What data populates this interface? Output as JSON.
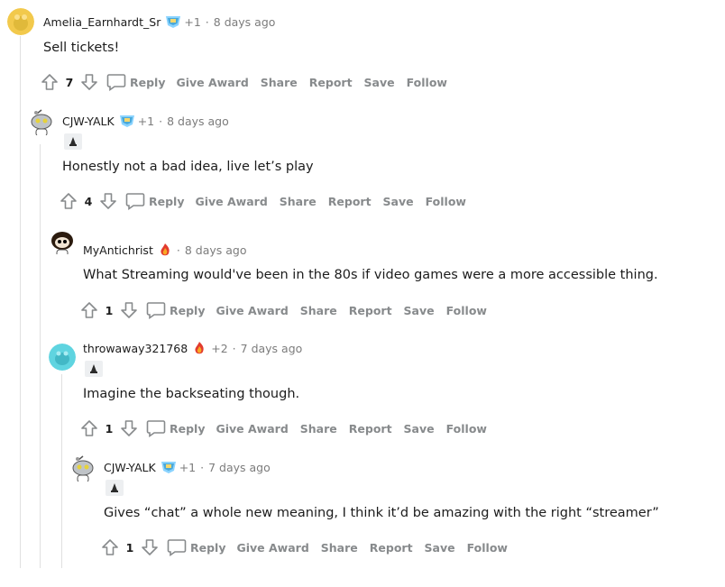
{
  "comments": [
    {
      "username": "Amelia_Earnhardt_Sr",
      "points": "+1",
      "time": "8 days ago",
      "body": "Sell tickets!",
      "score": "7",
      "avatar": "yellow-snoo"
    },
    {
      "username": "CJW-YALK",
      "points": "+1",
      "time": "8 days ago",
      "body": "Honestly not a bad idea, live let’s play",
      "score": "4",
      "avatar": "grey-snoo"
    },
    {
      "username": "MyAntichrist",
      "points": "",
      "time": "8 days ago",
      "body": "What Streaming would've been in the 80s if video games were a more accessible thing.",
      "score": "1",
      "avatar": "dark-hair-snoo"
    },
    {
      "username": "throwaway321768",
      "points": "+2",
      "time": "7 days ago",
      "body": "Imagine the backseating though.",
      "score": "1",
      "avatar": "teal-snoo"
    },
    {
      "username": "CJW-YALK",
      "points": "+1",
      "time": "7 days ago",
      "body": "Gives “chat” a whole new meaning, I think it’d be amazing with the right “streamer”",
      "score": "1",
      "avatar": "grey-snoo"
    }
  ],
  "actions": {
    "reply": "Reply",
    "give_award": "Give Award",
    "share": "Share",
    "report": "Report",
    "save": "Save",
    "follow": "Follow"
  },
  "separator": "·",
  "colors": {
    "meta_gray": "#7c7c7c",
    "action_gray": "#878a8c",
    "thread_line": "#e0e0e0",
    "yellow_avatar": "#f2c94c",
    "teal_avatar": "#5fd4e0"
  }
}
